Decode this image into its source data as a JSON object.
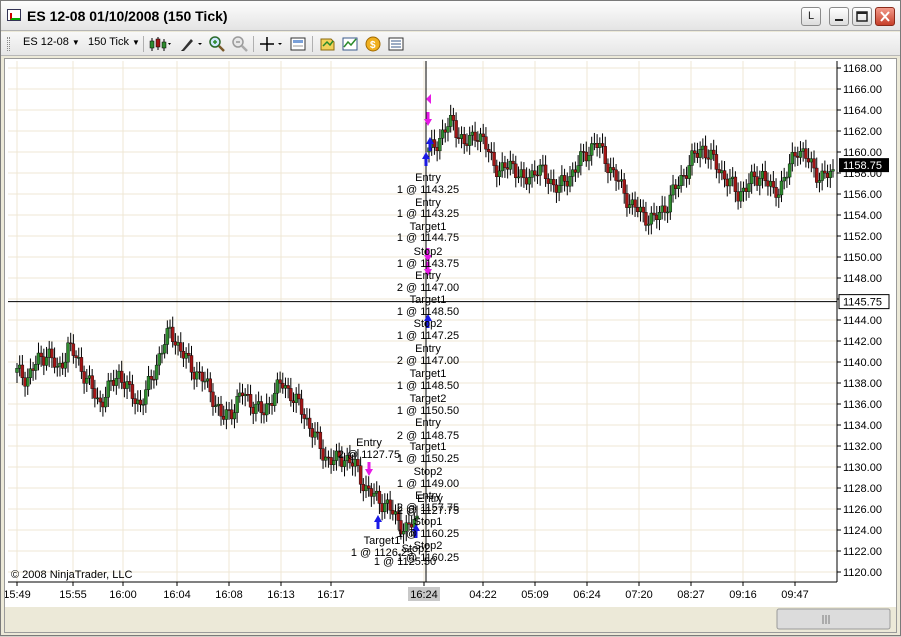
{
  "window": {
    "title": "ES 12-08  01/10/2008 (150 Tick)",
    "buttons": {
      "link": "L"
    }
  },
  "toolbar": {
    "instrument": "ES 12-08",
    "interval": "150 Tick"
  },
  "chart_data": {
    "type": "candlestick",
    "title": "",
    "xlabel": "",
    "ylabel": "",
    "ylim": [
      1119,
      1169
    ],
    "y_ticks": [
      "1168.00",
      "1166.00",
      "1164.00",
      "1162.00",
      "1160.00",
      "1158.00",
      "1156.00",
      "1154.00",
      "1152.00",
      "1150.00",
      "1148.00",
      "1146.00",
      "1144.00",
      "1142.00",
      "1140.00",
      "1138.00",
      "1136.00",
      "1134.00",
      "1132.00",
      "1130.00",
      "1128.00",
      "1126.00",
      "1124.00",
      "1122.00",
      "1120.00"
    ],
    "x_ticks": [
      "15:49",
      "15:55",
      "16:00",
      "16:04",
      "16:08",
      "16:13",
      "16:17",
      "16:24",
      "04:22",
      "05:09",
      "06:24",
      "07:20",
      "08:27",
      "09:16",
      "09:47"
    ],
    "highlighted_x_tick": "16:24",
    "last_price_label": "1158.75",
    "crosshair_price_label": "1145.75",
    "crosshair_price": 1145.75,
    "close_path": [
      1139.0,
      1138.5,
      1140.0,
      1141.0,
      1139.0,
      1141.5,
      1140.0,
      1138.0,
      1136.0,
      1137.5,
      1139.0,
      1137.0,
      1136.0,
      1138.0,
      1141.0,
      1143.0,
      1141.0,
      1139.5,
      1138.5,
      1137.0,
      1134.5,
      1135.5,
      1137.0,
      1136.0,
      1135.0,
      1137.0,
      1138.0,
      1136.5,
      1135.0,
      1133.0,
      1131.0,
      1130.5,
      1131.0,
      1130.0,
      1128.0,
      1127.0,
      1126.5,
      1125.0,
      1124.0,
      1125.0
    ],
    "close_path_2": [
      1160.0,
      1161.5,
      1163.0,
      1160.5,
      1162.0,
      1160.0,
      1158.0,
      1159.0,
      1157.0,
      1158.5,
      1157.5,
      1156.5,
      1158.0,
      1159.5,
      1161.0,
      1159.0,
      1157.0,
      1155.0,
      1154.0,
      1153.5,
      1155.0,
      1157.0,
      1159.0,
      1160.5,
      1159.0,
      1157.5,
      1156.0,
      1157.0,
      1158.0,
      1156.0,
      1157.5,
      1160.5,
      1159.0,
      1157.5,
      1158.0
    ],
    "trade_labels": [
      {
        "text": "Entry"
      },
      {
        "text": "2 @ 1127.75"
      },
      {
        "text": "Target1"
      },
      {
        "text": "1 @ 1126.25"
      },
      {
        "text": "Stop2"
      },
      {
        "text": "1 @ 1125.50"
      },
      {
        "text": "Entry"
      },
      {
        "text": "2 @ 1127.75"
      },
      {
        "text": "Entry"
      },
      {
        "text": "1 @ 1143.25"
      },
      {
        "text": "Entry"
      },
      {
        "text": "1 @ 1143.25"
      },
      {
        "text": "Target1"
      },
      {
        "text": "1 @ 1144.75"
      },
      {
        "text": "Stop2"
      },
      {
        "text": "1 @ 1143.75"
      },
      {
        "text": "Entry"
      },
      {
        "text": "2 @ 1147.00"
      },
      {
        "text": "Target1"
      },
      {
        "text": "1 @ 1148.50"
      },
      {
        "text": "Stop2"
      },
      {
        "text": "1 @ 1147.25"
      },
      {
        "text": "Entry"
      },
      {
        "text": "2 @ 1147.00"
      },
      {
        "text": "Target1"
      },
      {
        "text": "1 @ 1148.50"
      },
      {
        "text": "Target2"
      },
      {
        "text": "1 @ 1150.50"
      },
      {
        "text": "Entry"
      },
      {
        "text": "2 @ 1148.75"
      },
      {
        "text": "Target1"
      },
      {
        "text": "1 @ 1150.25"
      },
      {
        "text": "Stop2"
      },
      {
        "text": "1 @ 1149.00"
      },
      {
        "text": "Entry"
      },
      {
        "text": "2 @ 1157.75"
      },
      {
        "text": "Stop1"
      },
      {
        "text": "1 @ 1160.25"
      },
      {
        "text": "Stop2"
      },
      {
        "text": "1 @ 1160.25"
      }
    ],
    "copyright": "© 2008 NinjaTrader, LLC"
  },
  "colors": {
    "up_candle": "#2e8b2e",
    "down_candle": "#a31515",
    "grid": "#efe7d4",
    "buy_arrow": "#1a1ae6",
    "sell_arrow": "#e61ae6"
  }
}
